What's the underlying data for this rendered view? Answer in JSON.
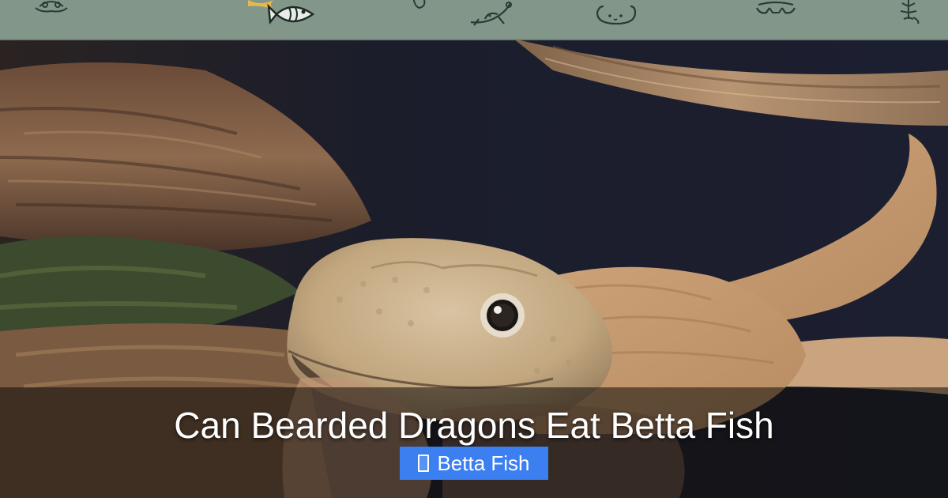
{
  "header": {
    "icons": [
      "frog-icon",
      "fish-icon",
      "snake-icon",
      "gecko-icon",
      "guinea-pig-icon",
      "turtle-icon",
      "scorpion-icon"
    ]
  },
  "post": {
    "title": "Can Bearded Dragons Eat Betta Fish",
    "tag": {
      "icon": "tag-icon",
      "label": "Betta Fish"
    }
  },
  "colors": {
    "banner": "#82978a",
    "tag_background": "#3b7ff1",
    "title_text": "#ffffff"
  }
}
